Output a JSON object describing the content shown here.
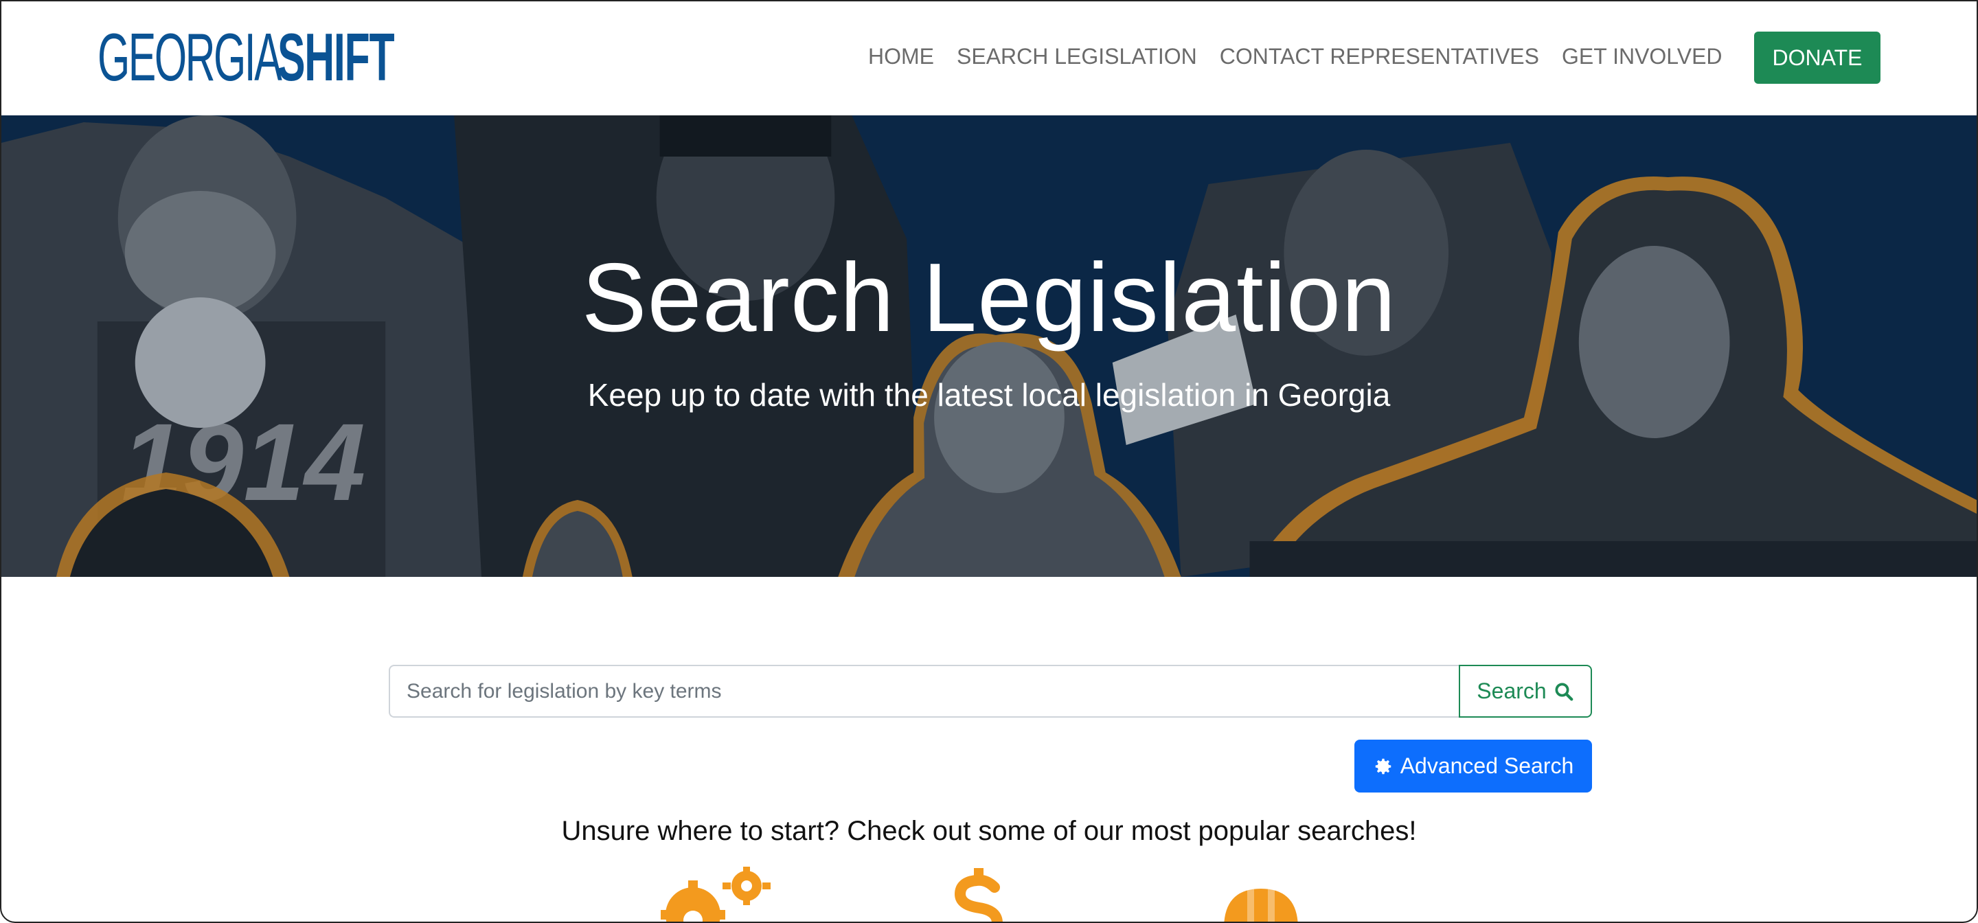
{
  "brand": {
    "logo_thin": "GEORGIA",
    "logo_bold": "SHIFT",
    "color": "#0b5394"
  },
  "nav": {
    "items": [
      "HOME",
      "SEARCH LEGISLATION",
      "CONTACT REPRESENTATIVES",
      "GET INVOLVED"
    ],
    "donate_label": "DONATE",
    "donate_color": "#1d8a55"
  },
  "hero": {
    "title": "Search Legislation",
    "subtitle": "Keep up to date with the latest local legislation in Georgia"
  },
  "search": {
    "placeholder": "Search for legislation by key terms",
    "value": "",
    "button_label": "Search",
    "button_icon": "search-icon",
    "advanced_label": "Advanced Search",
    "advanced_icon": "gear-icon"
  },
  "popular": {
    "heading": "Unsure where to start? Check out some of our most popular searches!",
    "icons": [
      "gears-icon",
      "dollar-icon",
      "hard-hat-icon"
    ],
    "icon_color": "#f39a1e"
  }
}
